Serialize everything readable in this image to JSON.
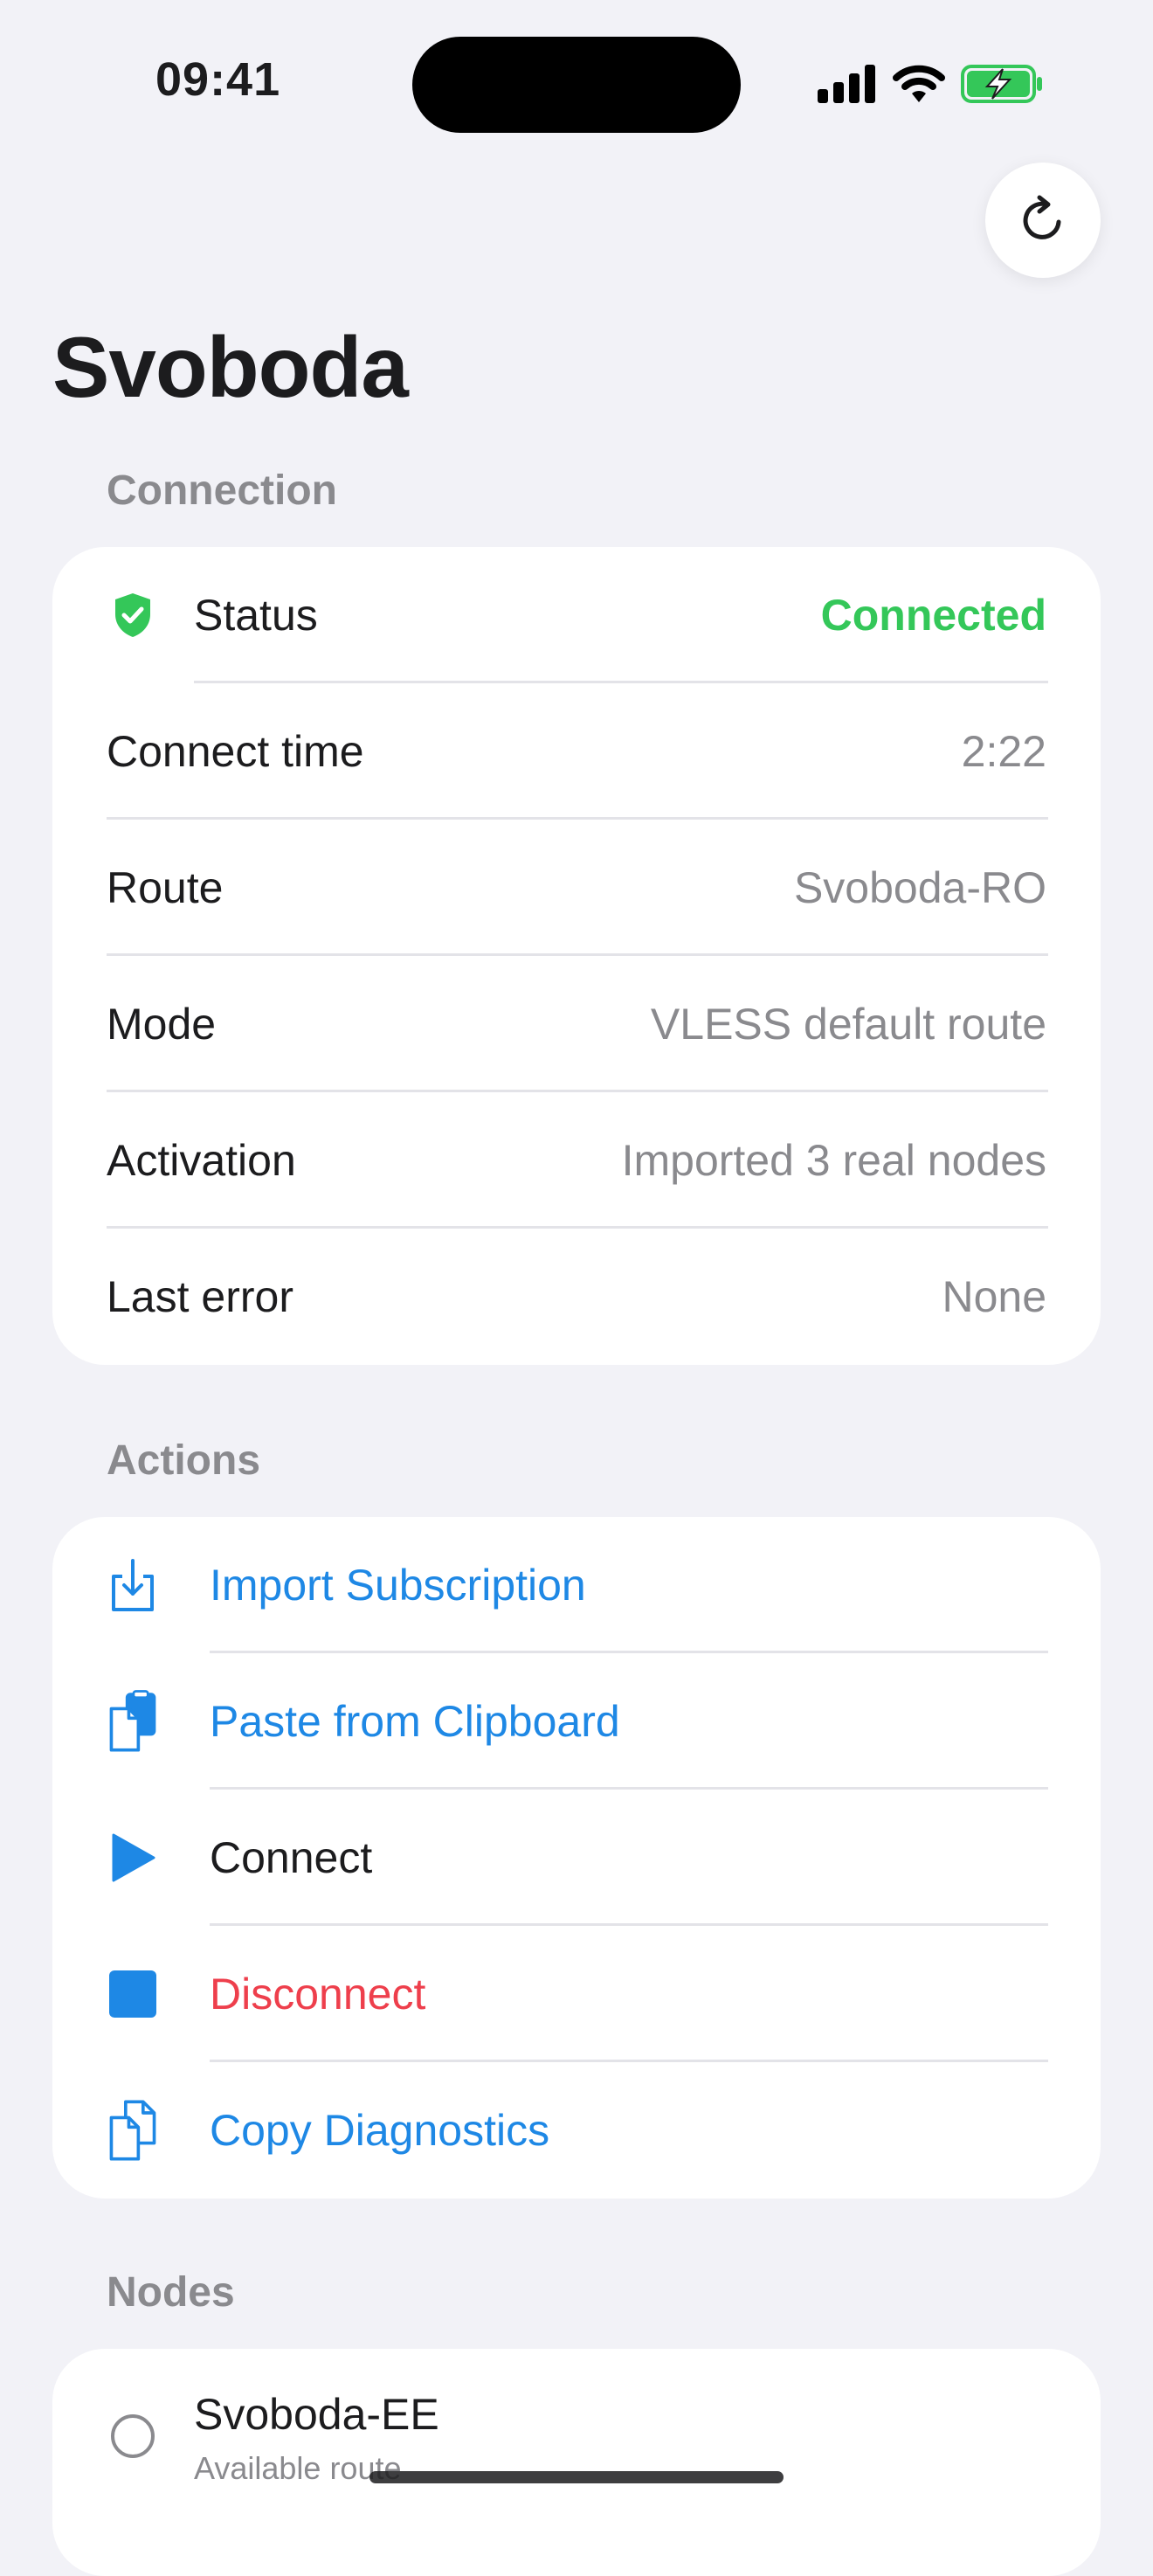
{
  "status_bar": {
    "time": "09:41",
    "icons": [
      "signal-icon",
      "wifi-icon",
      "battery-charging-icon"
    ]
  },
  "header": {
    "title": "Svoboda",
    "refresh_icon": "refresh-icon"
  },
  "colors": {
    "background": "#f2f2f7",
    "accent": "#1e88e5",
    "success": "#34c759",
    "danger": "#ee3f4c",
    "secondary_text": "#8a8a8e"
  },
  "connection": {
    "section_label": "Connection",
    "status": {
      "label": "Status",
      "value": "Connected",
      "icon": "shield-check-icon"
    },
    "rows": [
      {
        "label": "Connect time",
        "value": "2:22"
      },
      {
        "label": "Route",
        "value": "Svoboda-RO"
      },
      {
        "label": "Mode",
        "value": "VLESS default route"
      },
      {
        "label": "Activation",
        "value": "Imported 3 real nodes"
      },
      {
        "label": "Last error",
        "value": "None"
      }
    ]
  },
  "actions": {
    "section_label": "Actions",
    "items": [
      {
        "label": "Import Subscription",
        "icon": "import-icon"
      },
      {
        "label": "Paste from Clipboard",
        "icon": "clipboard-icon"
      },
      {
        "label": "Connect",
        "icon": "play-icon"
      },
      {
        "label": "Disconnect",
        "icon": "stop-icon"
      },
      {
        "label": "Copy Diagnostics",
        "icon": "copy-documents-icon"
      }
    ]
  },
  "nodes": {
    "section_label": "Nodes",
    "items": [
      {
        "name": "Svoboda-EE",
        "subtitle": "Available route",
        "selected": false
      }
    ]
  }
}
